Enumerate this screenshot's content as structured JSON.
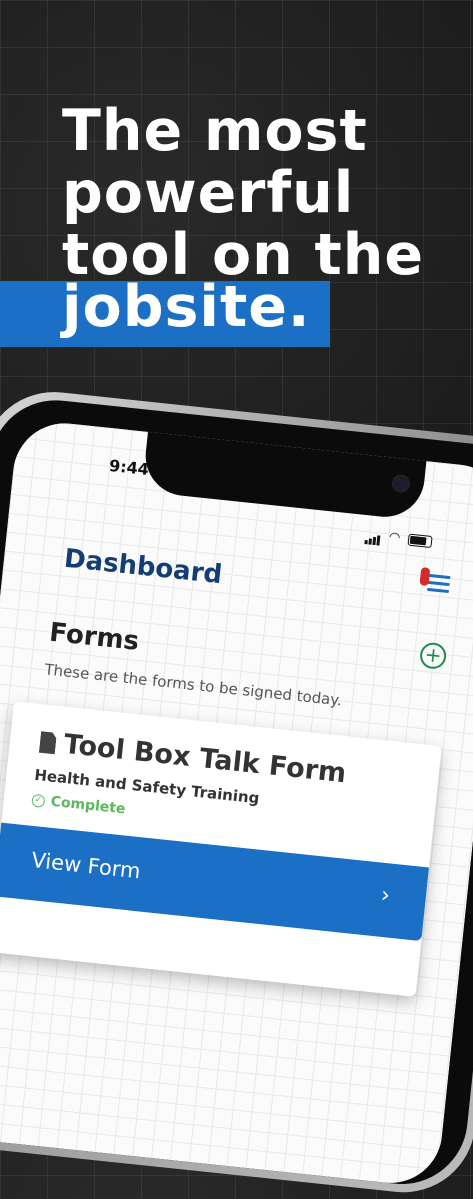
{
  "headline": {
    "line1": "The most",
    "line2": "powerful",
    "line3": "tool on the",
    "line4": "jobsite."
  },
  "colors": {
    "accent": "#1b6fc4",
    "title": "#143d75",
    "success": "#5cb85c",
    "add": "#1e8a4e"
  },
  "status_bar": {
    "time": "9:44"
  },
  "dashboard": {
    "title": "Dashboard",
    "forms_title": "Forms",
    "forms_subtitle": "These are the forms to be signed today.",
    "card": {
      "title": "Tool Box Talk Form",
      "subtitle": "Health and Safety Training",
      "status": "Complete",
      "button_label": "View Form"
    }
  },
  "icons": [
    "menu-icon",
    "add-icon",
    "document-icon",
    "check-circle-icon",
    "chevron-right-icon",
    "signal-icon",
    "wifi-icon",
    "battery-icon"
  ]
}
